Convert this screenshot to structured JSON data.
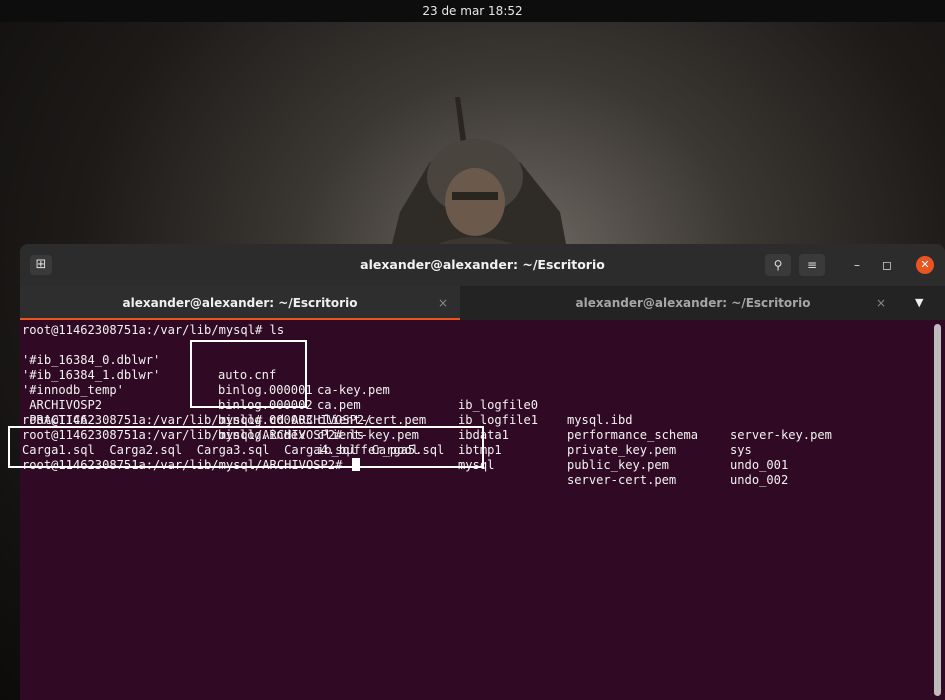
{
  "topbar": {
    "clock": "23 de mar  18:52"
  },
  "window": {
    "title": "alexander@alexander: ~/Escritorio",
    "tabs": [
      {
        "label": "alexander@alexander: ~/Escritorio",
        "active": true
      },
      {
        "label": "alexander@alexander: ~/Escritorio",
        "active": false
      }
    ],
    "icons": {
      "new_tab": "new-tab-icon",
      "search": "search-icon",
      "menu": "hamburger-menu-icon",
      "minimize": "minimize-icon",
      "maximize": "maximize-icon",
      "close": "close-icon",
      "tab_close": "close-icon",
      "tab_dropdown": "chevron-down-icon"
    }
  },
  "terminal": {
    "cmd1": "root@11462308751a:/var/lib/mysql# ls",
    "ls_rows": [
      [
        "'#ib_16384_0.dblwr'",
        "auto.cnf",
        "ca-key.pem",
        "ib_logfile0",
        "mysql.ibd",
        "server-key.pem"
      ],
      [
        "'#ib_16384_1.dblwr'",
        "binlog.000001",
        "ca.pem",
        "ib_logfile1",
        "performance_schema",
        "sys"
      ],
      [
        "'#innodb_temp'",
        "binlog.000002",
        "client-cert.pem",
        "ibdata1",
        "private_key.pem",
        "undo_001"
      ],
      [
        " ARCHIVOSP2",
        "binlog.000003",
        "client-key.pem",
        "ibtmp1",
        "public_key.pem",
        "undo_002"
      ],
      [
        " PRACTICA2",
        "binlog.index",
        "ib_buffer_pool",
        "mysql",
        "server-cert.pem",
        ""
      ]
    ],
    "cmd2": "root@11462308751a:/var/lib/mysql# cd ARCHIVOSP2/",
    "cmd3": "root@11462308751a:/var/lib/mysql/ARCHIVOSP2# ls",
    "ls2": "Carga1.sql  Carga2.sql  Carga3.sql  Carga4.sql  Carga5.sql",
    "prompt": "root@11462308751a:/var/lib/mysql/ARCHIVOSP2# "
  },
  "colors": {
    "terminal_bg": "#300a24",
    "accent": "#e95420",
    "highlight_box": "#ffffff"
  }
}
